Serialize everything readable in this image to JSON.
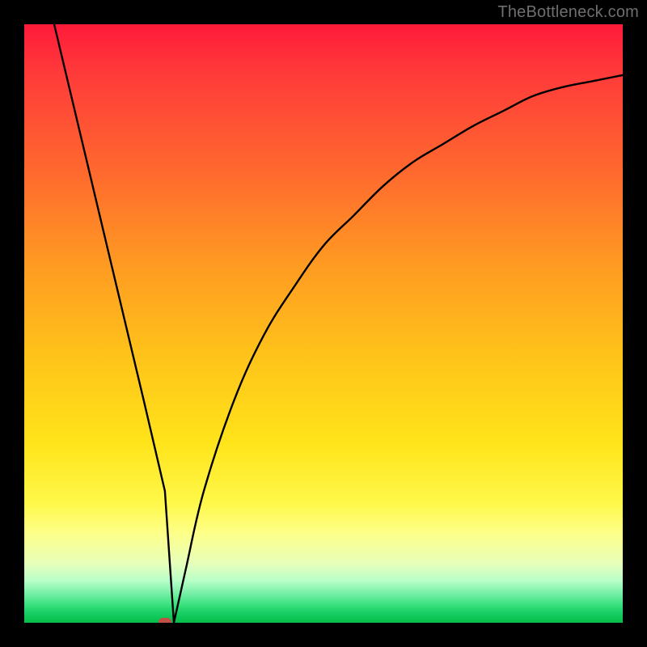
{
  "attribution": "TheBottleneck.com",
  "colors": {
    "frame_bg": "#000000",
    "curve_stroke": "#000000",
    "marker_fill": "#c05048",
    "attribution_color": "#6f6f6f"
  },
  "chart_data": {
    "type": "line",
    "title": "",
    "xlabel": "",
    "ylabel": "",
    "xlim": [
      0,
      100
    ],
    "ylim": [
      0,
      100
    ],
    "grid": false,
    "legend": false,
    "series": [
      {
        "name": "bottleneck-curve",
        "x": [
          5,
          10,
          15,
          20,
          23.5,
          25,
          27,
          30,
          35,
          40,
          45,
          50,
          55,
          60,
          65,
          70,
          75,
          80,
          85,
          90,
          95,
          100
        ],
        "values": [
          100,
          79,
          58,
          37,
          22,
          0,
          9,
          22,
          37,
          48,
          56,
          63,
          68,
          73,
          77,
          80,
          83,
          85.5,
          88,
          89.5,
          90.5,
          91.5
        ]
      }
    ],
    "marker": {
      "x": 23.5,
      "y": 0
    },
    "background_gradient": {
      "type": "vertical",
      "stops": [
        {
          "pos": 0.0,
          "color": "#ff1a3a"
        },
        {
          "pos": 0.08,
          "color": "#ff3a3a"
        },
        {
          "pos": 0.25,
          "color": "#ff6a2e"
        },
        {
          "pos": 0.4,
          "color": "#ff9a22"
        },
        {
          "pos": 0.55,
          "color": "#ffc21a"
        },
        {
          "pos": 0.7,
          "color": "#ffe41a"
        },
        {
          "pos": 0.8,
          "color": "#fff84a"
        },
        {
          "pos": 0.85,
          "color": "#fdff88"
        },
        {
          "pos": 0.9,
          "color": "#e8ffba"
        },
        {
          "pos": 0.93,
          "color": "#b8ffc8"
        },
        {
          "pos": 0.95,
          "color": "#7af0a8"
        },
        {
          "pos": 0.97,
          "color": "#3ae07e"
        },
        {
          "pos": 0.98,
          "color": "#1fd46a"
        },
        {
          "pos": 0.99,
          "color": "#10c85a"
        },
        {
          "pos": 1.0,
          "color": "#07be48"
        }
      ]
    }
  }
}
